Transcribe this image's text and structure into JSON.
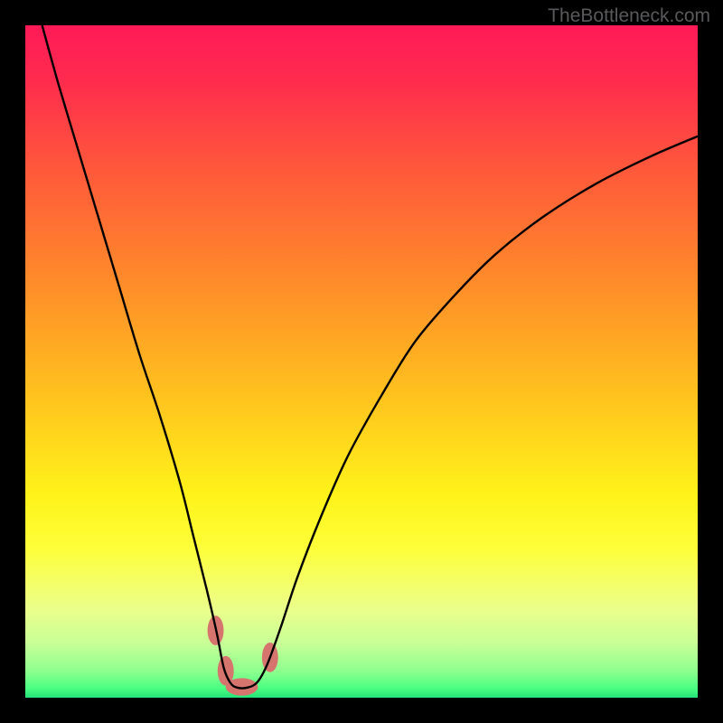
{
  "watermark": "TheBottleneck.com",
  "chart_data": {
    "type": "line",
    "title": "",
    "xlabel": "",
    "ylabel": "",
    "xlim": [
      0,
      100
    ],
    "ylim": [
      0,
      100
    ],
    "gradient_stops": [
      {
        "offset": 0.0,
        "color": "#ff1a57"
      },
      {
        "offset": 0.08,
        "color": "#ff2b4e"
      },
      {
        "offset": 0.22,
        "color": "#ff5a3a"
      },
      {
        "offset": 0.38,
        "color": "#ff8b2a"
      },
      {
        "offset": 0.55,
        "color": "#ffc21e"
      },
      {
        "offset": 0.7,
        "color": "#fff31a"
      },
      {
        "offset": 0.78,
        "color": "#fdff3a"
      },
      {
        "offset": 0.82,
        "color": "#f6ff60"
      },
      {
        "offset": 0.87,
        "color": "#eaff8c"
      },
      {
        "offset": 0.92,
        "color": "#c7ff97"
      },
      {
        "offset": 0.96,
        "color": "#8fff8f"
      },
      {
        "offset": 0.985,
        "color": "#4dff82"
      },
      {
        "offset": 1.0,
        "color": "#22e27a"
      }
    ],
    "series": [
      {
        "name": "bottleneck-curve",
        "stroke": "#000000",
        "stroke_width": 2.4,
        "x": [
          2.5,
          5,
          8,
          11,
          14,
          17,
          20,
          23,
          25,
          27,
          28.5,
          29.5,
          30.5,
          31.5,
          33,
          34.5,
          36,
          38,
          40.5,
          44,
          48,
          53,
          58,
          64,
          70,
          77,
          85,
          93,
          100
        ],
        "y": [
          100,
          91,
          81,
          71,
          61,
          51,
          42,
          32,
          24,
          16,
          9.5,
          4.5,
          2.2,
          1.5,
          1.5,
          2.3,
          5.0,
          10.5,
          18,
          27,
          36,
          45,
          53,
          60,
          66,
          71.5,
          76.5,
          80.5,
          83.5
        ]
      }
    ],
    "markers": [
      {
        "name": "marker-left-upper",
        "cx": 28.3,
        "cy": 10.0,
        "rx": 1.2,
        "ry": 2.2,
        "fill": "#d6746e"
      },
      {
        "name": "marker-left-lower",
        "cx": 29.8,
        "cy": 4.0,
        "rx": 1.2,
        "ry": 2.2,
        "fill": "#d6746e"
      },
      {
        "name": "marker-valley",
        "cx": 32.2,
        "cy": 1.6,
        "rx": 2.4,
        "ry": 1.3,
        "fill": "#d6746e"
      },
      {
        "name": "marker-right",
        "cx": 36.4,
        "cy": 6.0,
        "rx": 1.2,
        "ry": 2.2,
        "fill": "#d6746e"
      }
    ]
  }
}
